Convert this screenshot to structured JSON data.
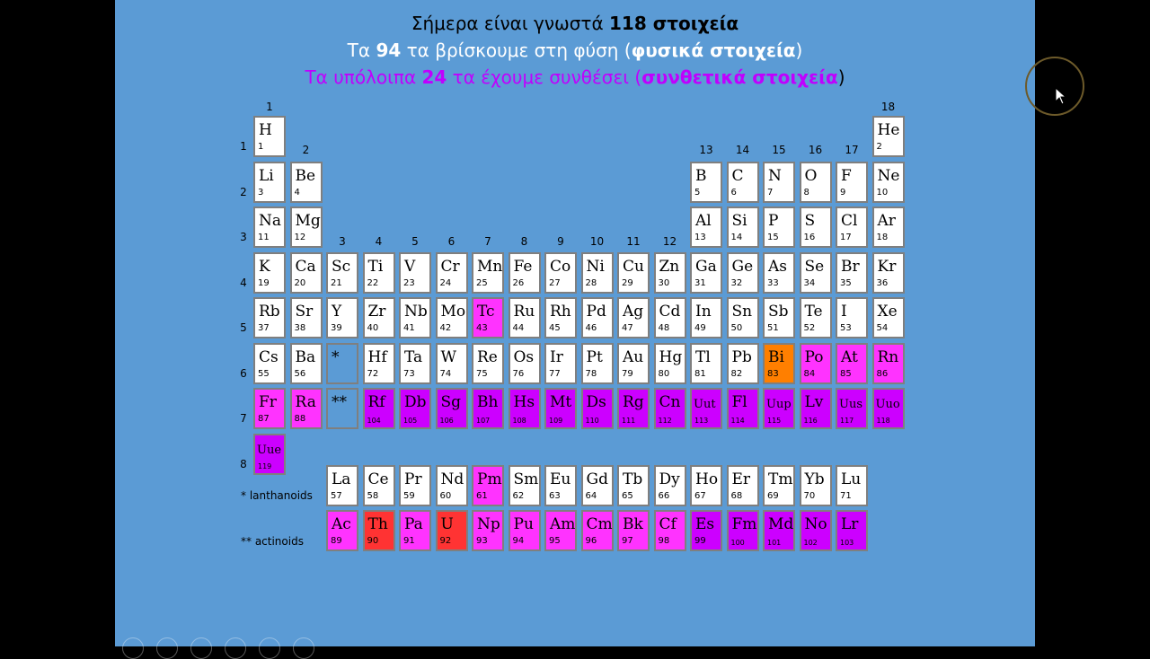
{
  "header": {
    "line1_pre": "Σήμερα είναι γνωστά ",
    "line1_bold": "118 στοιχεία",
    "line2_pre": "Τα ",
    "line2_bold1": "94",
    "line2_mid": " τα βρίσκουμε στη φύση (",
    "line2_bold2": "φυσικά στοιχεία",
    "line2_post": ")",
    "line3_pre": "Τα υπόλοιπα ",
    "line3_bold1": "24",
    "line3_mid": " τα έχουμε συνθέσει (",
    "line3_bold2": "συνθετικά στοιχεία",
    "line3_post": ")"
  },
  "colors": {
    "slide_bg": "#5b9bd5",
    "natural": "#ffffff",
    "pink": "#ff33ff",
    "purple": "#cc00ff",
    "orange": "#ff7f00",
    "red": "#ff3333",
    "headline_synthetic": "#c000ff"
  },
  "group_labels": [
    "1",
    "2",
    "3",
    "4",
    "5",
    "6",
    "7",
    "8",
    "9",
    "10",
    "11",
    "12",
    "13",
    "14",
    "15",
    "16",
    "17",
    "18"
  ],
  "period_labels": [
    "1",
    "2",
    "3",
    "4",
    "5",
    "6",
    "7",
    "8"
  ],
  "series_labels": {
    "lanthanoids": "* lanthanoids",
    "actinoids": "** actinoids"
  },
  "placeholders": {
    "lanthanoid": "*",
    "actinoid": "**"
  },
  "elements": [
    {
      "sym": "H",
      "num": "1",
      "row": 1,
      "col": 1,
      "c": "natural"
    },
    {
      "sym": "He",
      "num": "2",
      "row": 1,
      "col": 18,
      "c": "natural"
    },
    {
      "sym": "Li",
      "num": "3",
      "row": 2,
      "col": 1,
      "c": "natural"
    },
    {
      "sym": "Be",
      "num": "4",
      "row": 2,
      "col": 2,
      "c": "natural"
    },
    {
      "sym": "B",
      "num": "5",
      "row": 2,
      "col": 13,
      "c": "natural"
    },
    {
      "sym": "C",
      "num": "6",
      "row": 2,
      "col": 14,
      "c": "natural"
    },
    {
      "sym": "N",
      "num": "7",
      "row": 2,
      "col": 15,
      "c": "natural"
    },
    {
      "sym": "O",
      "num": "8",
      "row": 2,
      "col": 16,
      "c": "natural"
    },
    {
      "sym": "F",
      "num": "9",
      "row": 2,
      "col": 17,
      "c": "natural"
    },
    {
      "sym": "Ne",
      "num": "10",
      "row": 2,
      "col": 18,
      "c": "natural"
    },
    {
      "sym": "Na",
      "num": "11",
      "row": 3,
      "col": 1,
      "c": "natural"
    },
    {
      "sym": "Mg",
      "num": "12",
      "row": 3,
      "col": 2,
      "c": "natural"
    },
    {
      "sym": "Al",
      "num": "13",
      "row": 3,
      "col": 13,
      "c": "natural"
    },
    {
      "sym": "Si",
      "num": "14",
      "row": 3,
      "col": 14,
      "c": "natural"
    },
    {
      "sym": "P",
      "num": "15",
      "row": 3,
      "col": 15,
      "c": "natural"
    },
    {
      "sym": "S",
      "num": "16",
      "row": 3,
      "col": 16,
      "c": "natural"
    },
    {
      "sym": "Cl",
      "num": "17",
      "row": 3,
      "col": 17,
      "c": "natural"
    },
    {
      "sym": "Ar",
      "num": "18",
      "row": 3,
      "col": 18,
      "c": "natural"
    },
    {
      "sym": "K",
      "num": "19",
      "row": 4,
      "col": 1,
      "c": "natural"
    },
    {
      "sym": "Ca",
      "num": "20",
      "row": 4,
      "col": 2,
      "c": "natural"
    },
    {
      "sym": "Sc",
      "num": "21",
      "row": 4,
      "col": 3,
      "c": "natural"
    },
    {
      "sym": "Ti",
      "num": "22",
      "row": 4,
      "col": 4,
      "c": "natural"
    },
    {
      "sym": "V",
      "num": "23",
      "row": 4,
      "col": 5,
      "c": "natural"
    },
    {
      "sym": "Cr",
      "num": "24",
      "row": 4,
      "col": 6,
      "c": "natural"
    },
    {
      "sym": "Mn",
      "num": "25",
      "row": 4,
      "col": 7,
      "c": "natural"
    },
    {
      "sym": "Fe",
      "num": "26",
      "row": 4,
      "col": 8,
      "c": "natural"
    },
    {
      "sym": "Co",
      "num": "27",
      "row": 4,
      "col": 9,
      "c": "natural"
    },
    {
      "sym": "Ni",
      "num": "28",
      "row": 4,
      "col": 10,
      "c": "natural"
    },
    {
      "sym": "Cu",
      "num": "29",
      "row": 4,
      "col": 11,
      "c": "natural"
    },
    {
      "sym": "Zn",
      "num": "30",
      "row": 4,
      "col": 12,
      "c": "natural"
    },
    {
      "sym": "Ga",
      "num": "31",
      "row": 4,
      "col": 13,
      "c": "natural"
    },
    {
      "sym": "Ge",
      "num": "32",
      "row": 4,
      "col": 14,
      "c": "natural"
    },
    {
      "sym": "As",
      "num": "33",
      "row": 4,
      "col": 15,
      "c": "natural"
    },
    {
      "sym": "Se",
      "num": "34",
      "row": 4,
      "col": 16,
      "c": "natural"
    },
    {
      "sym": "Br",
      "num": "35",
      "row": 4,
      "col": 17,
      "c": "natural"
    },
    {
      "sym": "Kr",
      "num": "36",
      "row": 4,
      "col": 18,
      "c": "natural"
    },
    {
      "sym": "Rb",
      "num": "37",
      "row": 5,
      "col": 1,
      "c": "natural"
    },
    {
      "sym": "Sr",
      "num": "38",
      "row": 5,
      "col": 2,
      "c": "natural"
    },
    {
      "sym": "Y",
      "num": "39",
      "row": 5,
      "col": 3,
      "c": "natural"
    },
    {
      "sym": "Zr",
      "num": "40",
      "row": 5,
      "col": 4,
      "c": "natural"
    },
    {
      "sym": "Nb",
      "num": "41",
      "row": 5,
      "col": 5,
      "c": "natural"
    },
    {
      "sym": "Mo",
      "num": "42",
      "row": 5,
      "col": 6,
      "c": "natural"
    },
    {
      "sym": "Tc",
      "num": "43",
      "row": 5,
      "col": 7,
      "c": "pink"
    },
    {
      "sym": "Ru",
      "num": "44",
      "row": 5,
      "col": 8,
      "c": "natural"
    },
    {
      "sym": "Rh",
      "num": "45",
      "row": 5,
      "col": 9,
      "c": "natural"
    },
    {
      "sym": "Pd",
      "num": "46",
      "row": 5,
      "col": 10,
      "c": "natural"
    },
    {
      "sym": "Ag",
      "num": "47",
      "row": 5,
      "col": 11,
      "c": "natural"
    },
    {
      "sym": "Cd",
      "num": "48",
      "row": 5,
      "col": 12,
      "c": "natural"
    },
    {
      "sym": "In",
      "num": "49",
      "row": 5,
      "col": 13,
      "c": "natural"
    },
    {
      "sym": "Sn",
      "num": "50",
      "row": 5,
      "col": 14,
      "c": "natural"
    },
    {
      "sym": "Sb",
      "num": "51",
      "row": 5,
      "col": 15,
      "c": "natural"
    },
    {
      "sym": "Te",
      "num": "52",
      "row": 5,
      "col": 16,
      "c": "natural"
    },
    {
      "sym": "I",
      "num": "53",
      "row": 5,
      "col": 17,
      "c": "natural"
    },
    {
      "sym": "Xe",
      "num": "54",
      "row": 5,
      "col": 18,
      "c": "natural"
    },
    {
      "sym": "Cs",
      "num": "55",
      "row": 6,
      "col": 1,
      "c": "natural"
    },
    {
      "sym": "Ba",
      "num": "56",
      "row": 6,
      "col": 2,
      "c": "natural"
    },
    {
      "sym": "Hf",
      "num": "72",
      "row": 6,
      "col": 4,
      "c": "natural"
    },
    {
      "sym": "Ta",
      "num": "73",
      "row": 6,
      "col": 5,
      "c": "natural"
    },
    {
      "sym": "W",
      "num": "74",
      "row": 6,
      "col": 6,
      "c": "natural"
    },
    {
      "sym": "Re",
      "num": "75",
      "row": 6,
      "col": 7,
      "c": "natural"
    },
    {
      "sym": "Os",
      "num": "76",
      "row": 6,
      "col": 8,
      "c": "natural"
    },
    {
      "sym": "Ir",
      "num": "77",
      "row": 6,
      "col": 9,
      "c": "natural"
    },
    {
      "sym": "Pt",
      "num": "78",
      "row": 6,
      "col": 10,
      "c": "natural"
    },
    {
      "sym": "Au",
      "num": "79",
      "row": 6,
      "col": 11,
      "c": "natural"
    },
    {
      "sym": "Hg",
      "num": "80",
      "row": 6,
      "col": 12,
      "c": "natural"
    },
    {
      "sym": "Tl",
      "num": "81",
      "row": 6,
      "col": 13,
      "c": "natural"
    },
    {
      "sym": "Pb",
      "num": "82",
      "row": 6,
      "col": 14,
      "c": "natural"
    },
    {
      "sym": "Bi",
      "num": "83",
      "row": 6,
      "col": 15,
      "c": "orange"
    },
    {
      "sym": "Po",
      "num": "84",
      "row": 6,
      "col": 16,
      "c": "pink"
    },
    {
      "sym": "At",
      "num": "85",
      "row": 6,
      "col": 17,
      "c": "pink"
    },
    {
      "sym": "Rn",
      "num": "86",
      "row": 6,
      "col": 18,
      "c": "pink"
    },
    {
      "sym": "Fr",
      "num": "87",
      "row": 7,
      "col": 1,
      "c": "pink"
    },
    {
      "sym": "Ra",
      "num": "88",
      "row": 7,
      "col": 2,
      "c": "pink"
    },
    {
      "sym": "Rf",
      "num": "104",
      "row": 7,
      "col": 4,
      "c": "purple"
    },
    {
      "sym": "Db",
      "num": "105",
      "row": 7,
      "col": 5,
      "c": "purple"
    },
    {
      "sym": "Sg",
      "num": "106",
      "row": 7,
      "col": 6,
      "c": "purple"
    },
    {
      "sym": "Bh",
      "num": "107",
      "row": 7,
      "col": 7,
      "c": "purple"
    },
    {
      "sym": "Hs",
      "num": "108",
      "row": 7,
      "col": 8,
      "c": "purple"
    },
    {
      "sym": "Mt",
      "num": "109",
      "row": 7,
      "col": 9,
      "c": "purple"
    },
    {
      "sym": "Ds",
      "num": "110",
      "row": 7,
      "col": 10,
      "c": "purple"
    },
    {
      "sym": "Rg",
      "num": "111",
      "row": 7,
      "col": 11,
      "c": "purple"
    },
    {
      "sym": "Cn",
      "num": "112",
      "row": 7,
      "col": 12,
      "c": "purple"
    },
    {
      "sym": "Uut",
      "num": "113",
      "row": 7,
      "col": 13,
      "c": "purple"
    },
    {
      "sym": "Fl",
      "num": "114",
      "row": 7,
      "col": 14,
      "c": "purple"
    },
    {
      "sym": "Uup",
      "num": "115",
      "row": 7,
      "col": 15,
      "c": "purple"
    },
    {
      "sym": "Lv",
      "num": "116",
      "row": 7,
      "col": 16,
      "c": "purple"
    },
    {
      "sym": "Uus",
      "num": "117",
      "row": 7,
      "col": 17,
      "c": "purple"
    },
    {
      "sym": "Uuo",
      "num": "118",
      "row": 7,
      "col": 18,
      "c": "purple"
    },
    {
      "sym": "Uue",
      "num": "119",
      "row": 8,
      "col": 1,
      "c": "purple"
    },
    {
      "sym": "La",
      "num": "57",
      "row": 9,
      "col": 3,
      "c": "natural"
    },
    {
      "sym": "Ce",
      "num": "58",
      "row": 9,
      "col": 4,
      "c": "natural"
    },
    {
      "sym": "Pr",
      "num": "59",
      "row": 9,
      "col": 5,
      "c": "natural"
    },
    {
      "sym": "Nd",
      "num": "60",
      "row": 9,
      "col": 6,
      "c": "natural"
    },
    {
      "sym": "Pm",
      "num": "61",
      "row": 9,
      "col": 7,
      "c": "pink"
    },
    {
      "sym": "Sm",
      "num": "62",
      "row": 9,
      "col": 8,
      "c": "natural"
    },
    {
      "sym": "Eu",
      "num": "63",
      "row": 9,
      "col": 9,
      "c": "natural"
    },
    {
      "sym": "Gd",
      "num": "64",
      "row": 9,
      "col": 10,
      "c": "natural"
    },
    {
      "sym": "Tb",
      "num": "65",
      "row": 9,
      "col": 11,
      "c": "natural"
    },
    {
      "sym": "Dy",
      "num": "66",
      "row": 9,
      "col": 12,
      "c": "natural"
    },
    {
      "sym": "Ho",
      "num": "67",
      "row": 9,
      "col": 13,
      "c": "natural"
    },
    {
      "sym": "Er",
      "num": "68",
      "row": 9,
      "col": 14,
      "c": "natural"
    },
    {
      "sym": "Tm",
      "num": "69",
      "row": 9,
      "col": 15,
      "c": "natural"
    },
    {
      "sym": "Yb",
      "num": "70",
      "row": 9,
      "col": 16,
      "c": "natural"
    },
    {
      "sym": "Lu",
      "num": "71",
      "row": 9,
      "col": 17,
      "c": "natural"
    },
    {
      "sym": "Ac",
      "num": "89",
      "row": 10,
      "col": 3,
      "c": "pink"
    },
    {
      "sym": "Th",
      "num": "90",
      "row": 10,
      "col": 4,
      "c": "red"
    },
    {
      "sym": "Pa",
      "num": "91",
      "row": 10,
      "col": 5,
      "c": "pink"
    },
    {
      "sym": "U",
      "num": "92",
      "row": 10,
      "col": 6,
      "c": "red"
    },
    {
      "sym": "Np",
      "num": "93",
      "row": 10,
      "col": 7,
      "c": "pink"
    },
    {
      "sym": "Pu",
      "num": "94",
      "row": 10,
      "col": 8,
      "c": "pink"
    },
    {
      "sym": "Am",
      "num": "95",
      "row": 10,
      "col": 9,
      "c": "pink"
    },
    {
      "sym": "Cm",
      "num": "96",
      "row": 10,
      "col": 10,
      "c": "pink"
    },
    {
      "sym": "Bk",
      "num": "97",
      "row": 10,
      "col": 11,
      "c": "pink"
    },
    {
      "sym": "Cf",
      "num": "98",
      "row": 10,
      "col": 12,
      "c": "pink"
    },
    {
      "sym": "Es",
      "num": "99",
      "row": 10,
      "col": 13,
      "c": "purple"
    },
    {
      "sym": "Fm",
      "num": "100",
      "row": 10,
      "col": 14,
      "c": "purple"
    },
    {
      "sym": "Md",
      "num": "101",
      "row": 10,
      "col": 15,
      "c": "purple"
    },
    {
      "sym": "No",
      "num": "102",
      "row": 10,
      "col": 16,
      "c": "purple"
    },
    {
      "sym": "Lr",
      "num": "103",
      "row": 10,
      "col": 17,
      "c": "purple"
    }
  ]
}
